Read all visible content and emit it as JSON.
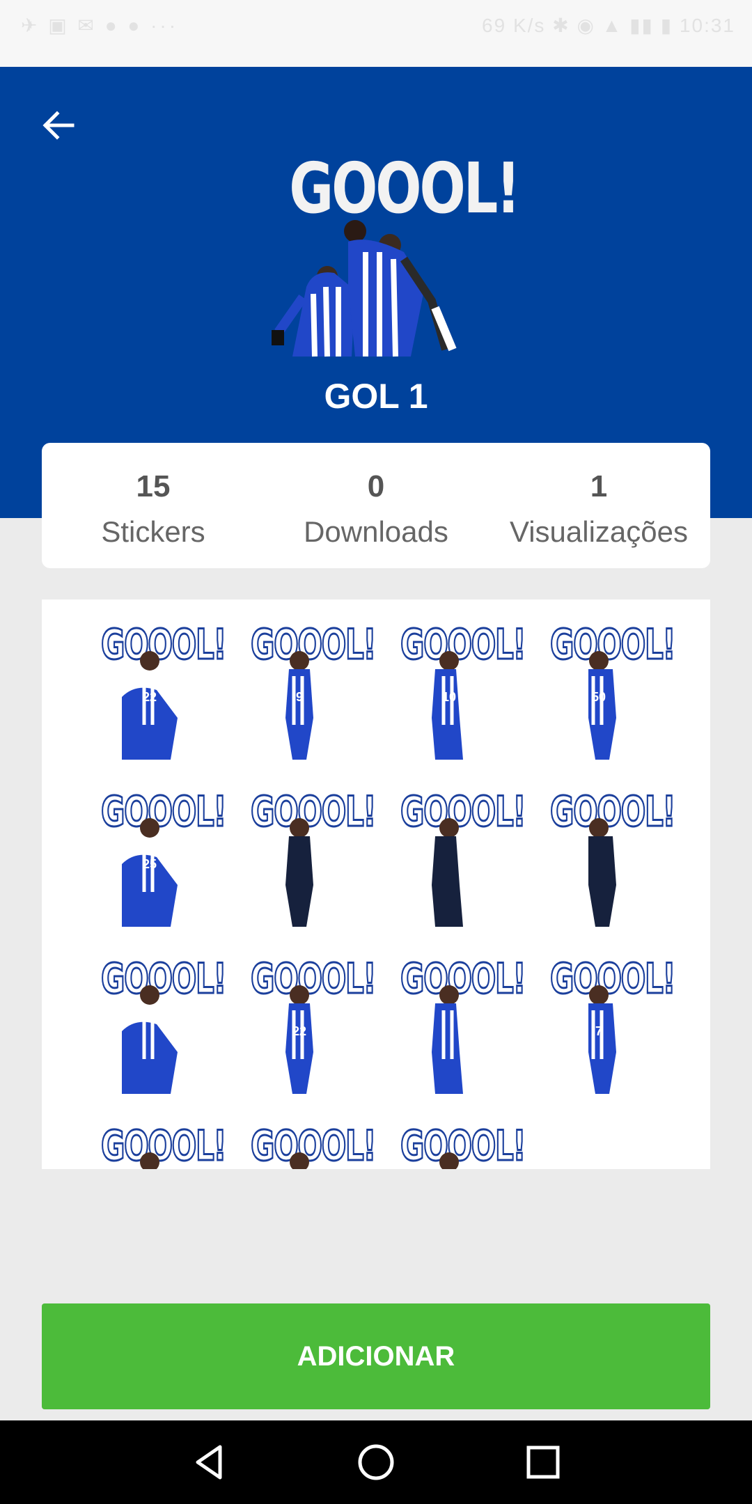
{
  "status_bar": {
    "left": "✈ ▣ ✉ ● ● ···",
    "right": "69 K/s ✱ ◉ ▲ ▮▮ ▮ 10:31"
  },
  "header": {
    "hero_title": "GOOOL!",
    "pack_title": "GOL 1"
  },
  "stats": [
    {
      "value": "15",
      "label": "Stickers"
    },
    {
      "value": "0",
      "label": "Downloads"
    },
    {
      "value": "1",
      "label": "Visualizações"
    }
  ],
  "stickers": [
    {
      "text": "GOOOL!",
      "number": "22"
    },
    {
      "text": "GOOOL!",
      "number": "9"
    },
    {
      "text": "GOOOL!",
      "number": "10"
    },
    {
      "text": "GOOOL!",
      "number": "50"
    },
    {
      "text": "GOOOL!",
      "number": "25"
    },
    {
      "text": "GOOOL!",
      "number": ""
    },
    {
      "text": "GOOOL!",
      "number": ""
    },
    {
      "text": "GOOOL!",
      "number": ""
    },
    {
      "text": "GOOOL!",
      "number": ""
    },
    {
      "text": "GOOOL!",
      "number": "22"
    },
    {
      "text": "GOOOL!",
      "number": ""
    },
    {
      "text": "GOOOL!",
      "number": "7"
    },
    {
      "text": "GOOOL!",
      "number": ""
    },
    {
      "text": "GOOOL!",
      "number": ""
    },
    {
      "text": "GOOOL!",
      "number": ""
    }
  ],
  "colors": {
    "header": "#00429c",
    "button": "#4cbb3a",
    "kit_blue": "#2147c8"
  },
  "add_button": {
    "label": "ADICIONAR"
  },
  "icons": {
    "back": "arrow-left-icon",
    "nav_back": "triangle-back-icon",
    "nav_home": "circle-home-icon",
    "nav_recent": "square-recent-icon"
  }
}
